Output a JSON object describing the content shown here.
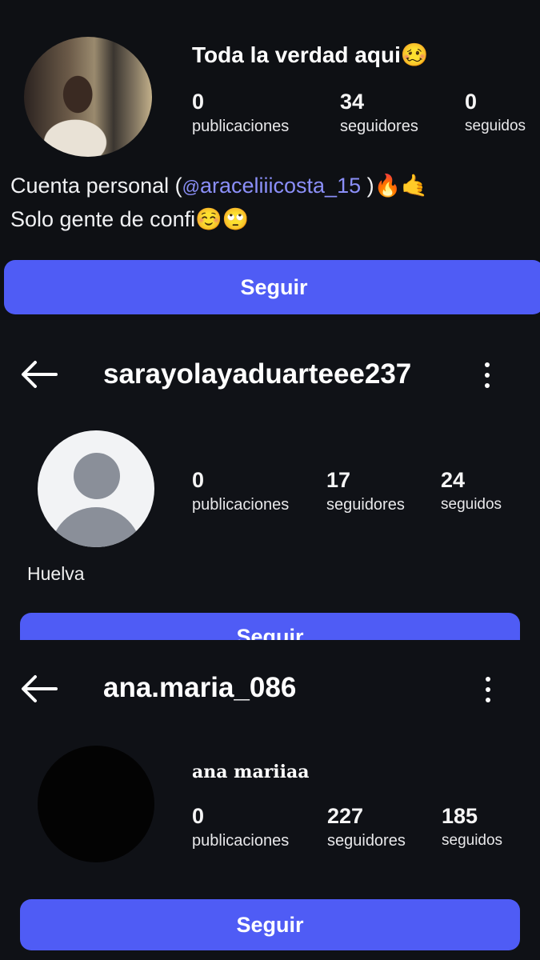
{
  "profile1": {
    "display_name": "Toda la verdad aqui🥴",
    "stats": [
      {
        "value": "0",
        "label": "publicaciones"
      },
      {
        "value": "34",
        "label": "seguidores"
      },
      {
        "value": "0",
        "label": "seguidos"
      }
    ],
    "bio_prefix": "Cuenta personal (",
    "bio_mention": "araceliiicosta_15",
    "bio_suffix": " )🔥🤙",
    "bio_line2": "Solo gente de confi☺️🙄",
    "follow_label": "Seguir"
  },
  "profile2": {
    "username": "sarayolayaduarteee237",
    "stats": [
      {
        "value": "0",
        "label": "publicaciones"
      },
      {
        "value": "17",
        "label": "seguidores"
      },
      {
        "value": "24",
        "label": "seguidos"
      }
    ],
    "location": "Huelva",
    "follow_label": "Seguir"
  },
  "profile3": {
    "username": "ana.maria_086",
    "display_name": "ana mariiaa",
    "stats": [
      {
        "value": "0",
        "label": "publicaciones"
      },
      {
        "value": "227",
        "label": "seguidores"
      },
      {
        "value": "185",
        "label": "seguidos"
      }
    ],
    "follow_label": "Seguir"
  },
  "icons": {
    "back": "back-arrow-icon",
    "more": "more-vertical-icon",
    "threads": "threads-icon"
  },
  "colors": {
    "background": "#0e1014",
    "accent": "#4f5cf5",
    "mention": "#8b8ff8"
  }
}
